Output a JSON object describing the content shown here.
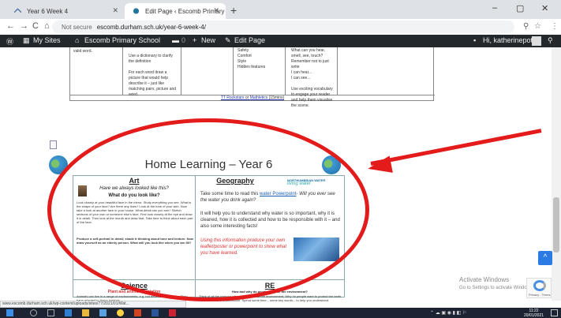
{
  "browser": {
    "tabs": [
      {
        "label": "Year 6 Week 4",
        "active": false
      },
      {
        "label": "Edit Page ‹ Escomb Primary Scho",
        "active": true
      }
    ],
    "new_tab": "+",
    "window_controls": [
      "–",
      "▢",
      "✕"
    ],
    "nav": {
      "back": "←",
      "forward": "→",
      "reload": "C",
      "home": "⌂"
    },
    "security": "Not secure",
    "url": "escomb.durham.sch.uk/year-6-week-4/"
  },
  "admin_bar": {
    "my_sites": "My Sites",
    "site_name": "Escomb Primary School",
    "comments_count": "0",
    "new_label": "New",
    "edit_label": "Edit Page",
    "greeting": "Hi, katherinepotts"
  },
  "table": {
    "col1": "valid word.",
    "col2": "Use a dictionary to clarify the definition\n\nFor each word draw a picture that would help describe it – just like matching pairs, picture and word.",
    "col3": "Safety\nComfort\nStyle\nHidden features",
    "col4": "What can you hear, smell, see, touch?\nRemember not to just write\nI can hear...\nI can see...\n\nUse exciting vocabulary to engage your reader and help them visualise the scene.",
    "link1": "TT Rockstars",
    "link_sep": " or ",
    "link2": "Mathletics",
    "link_suffix": " (15mins)"
  },
  "document": {
    "title": "Home Learning – Year 6",
    "art": {
      "heading": "Art",
      "subheading": "Have we always looked like this?",
      "question": "What do you look like?",
      "body": "Look closely at your beautiful face in the mirror. Study everything you see. What is the shape of your face? Are there any lines? Look at the tone of your skin. Now take a look at another face in your house. What detail can you see? Sketch sections of your own or someone else's face. First look closely at the eye and draw it in detail. Then look at the mouth and draw that. Take time to think about each part of the face.",
      "task": "Produce a self-portrait in detail; shade it thinking about tone and texture. Now draw yourself as an elderly person. What will you look like when you are 80?"
    },
    "geography": {
      "heading": "Geography",
      "badge": "NORTHUMBRIAN WATER",
      "badge_sub": "living water",
      "intro_prefix": "Take some time to read this ",
      "intro_link": "water Powerpoint",
      "intro_suffix": "- Will you ever see the water you drink again?",
      "body": "It will help you to understand why water is so important, why it is cleaned, how it is collected and how to be responsible with it – and also some interesting facts!",
      "task": "Using this information produce your own leaflet/poster or powerpoint to show what you have learned."
    },
    "science": {
      "heading": "Science",
      "subheading": "Plant and animal adaptation",
      "body": "Animals can live in a range of environments, e.g. hot deserts & Antarctica. They have adapted to these habitats."
    },
    "re": {
      "heading": "RE",
      "subheading": "How and why do people care for the environment?",
      "body": "Think of all the reasons why people care for the environment. Why do people want to protect the earth we live in? Have a discussion. Spend some time... some key words... to help you understand."
    }
  },
  "overlay": {
    "activate_title": "Activate Windows",
    "activate_sub": "Go to Settings to activate Windows.",
    "scroll_up": "^",
    "captcha_text": "Privacy - Terms"
  },
  "status_url": "www.escomb.durham.sch.uk/wp-content/uploads/sites/77/2021/01/Wat...",
  "taskbar": {
    "time": "11:22",
    "date": "20/01/2021"
  },
  "colors": {
    "admin_bar": "#23282d",
    "annotation_red": "#e31b1b",
    "link_blue": "#1a5fb4"
  }
}
